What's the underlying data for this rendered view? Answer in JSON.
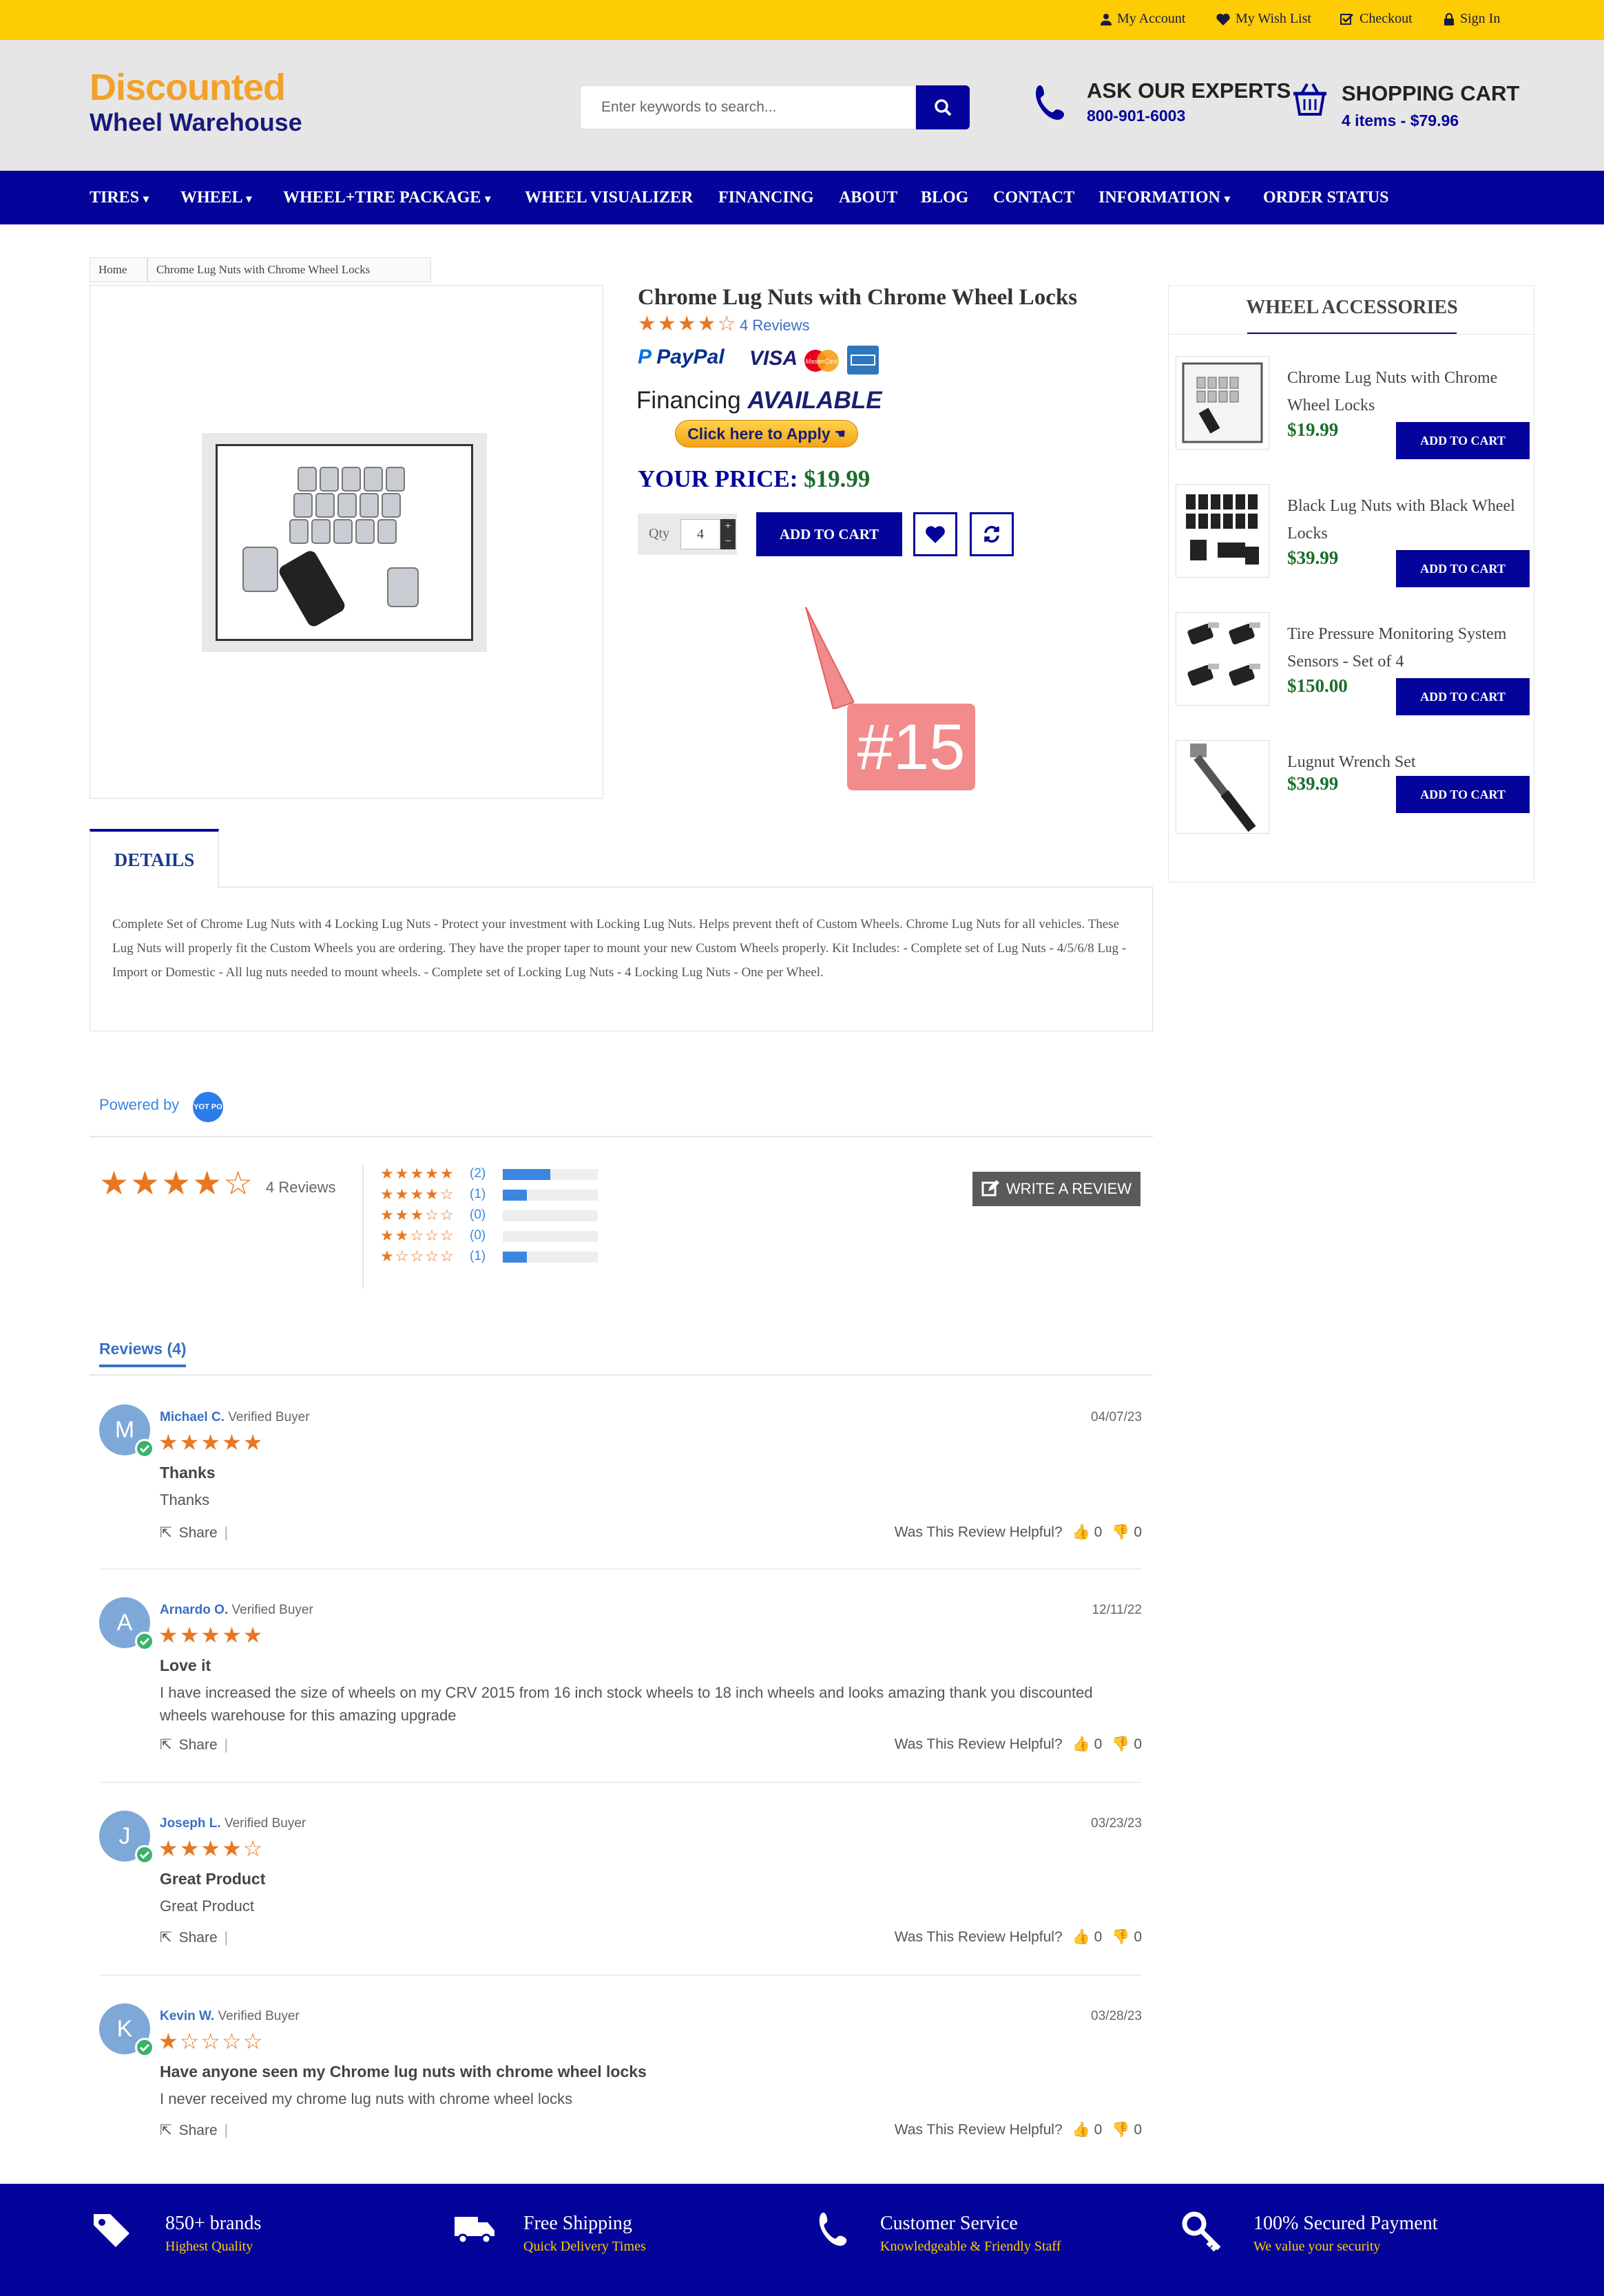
{
  "topbar": {
    "my_account": "My Account",
    "wish_list": "My Wish List",
    "checkout": "Checkout",
    "sign_in": "Sign In"
  },
  "header": {
    "logo_line1": "Discounted",
    "logo_line2": "Wheel Warehouse",
    "search_placeholder": "Enter keywords to search...",
    "experts_label": "ASK OUR EXPERTS",
    "experts_phone": "800-901-6003",
    "cart_label": "SHOPPING CART",
    "cart_summary": "4 items - $79.96"
  },
  "nav": [
    {
      "label": "TIRES",
      "dropdown": true
    },
    {
      "label": "WHEEL",
      "dropdown": true
    },
    {
      "label": "WHEEL+TIRE PACKAGE",
      "dropdown": true
    },
    {
      "label": "WHEEL VISUALIZER",
      "dropdown": false
    },
    {
      "label": "FINANCING",
      "dropdown": false
    },
    {
      "label": "ABOUT",
      "dropdown": false
    },
    {
      "label": "BLOG",
      "dropdown": false
    },
    {
      "label": "CONTACT",
      "dropdown": false
    },
    {
      "label": "INFORMATION",
      "dropdown": true
    },
    {
      "label": "ORDER STATUS",
      "dropdown": false
    }
  ],
  "breadcrumb": {
    "home": "Home",
    "current": "Chrome Lug Nuts with Chrome Wheel Locks"
  },
  "product": {
    "title": "Chrome Lug Nuts with Chrome Wheel Locks",
    "rating": 4,
    "reviews_link": "4 Reviews",
    "payments": {
      "paypal": "PayPal",
      "visa": "VISA",
      "mastercard": "MasterCard"
    },
    "financing_label": "Financing",
    "financing_available": "AVAILABLE",
    "financing_apply": "Click here to Apply",
    "price_label": "YOUR PRICE:",
    "price": "$19.99",
    "qty_label": "Qty",
    "qty_value": "4",
    "add_to_cart": "ADD TO CART"
  },
  "annotation": {
    "label": "#15",
    "color": "#f28b8b"
  },
  "sidebar": {
    "title": "WHEEL ACCESSORIES",
    "items": [
      {
        "name": "Chrome Lug Nuts with Chrome Wheel Locks",
        "price": "$19.99",
        "button": "ADD TO CART"
      },
      {
        "name": "Black Lug Nuts with Black Wheel Locks",
        "price": "$39.99",
        "button": "ADD TO CART"
      },
      {
        "name": "Tire Pressure Monitoring System Sensors - Set of 4",
        "price": "$150.00",
        "button": "ADD TO CART"
      },
      {
        "name": "Lugnut Wrench Set",
        "price": "$39.99",
        "button": "ADD TO CART"
      }
    ]
  },
  "details": {
    "tab": "DETAILS",
    "text": "Complete Set of Chrome Lug Nuts with 4 Locking Lug Nuts - Protect your investment with Locking Lug Nuts. Helps prevent theft of Custom Wheels. Chrome Lug Nuts for all vehicles. These Lug Nuts will properly fit the Custom Wheels you are ordering. They have the proper taper to mount your new Custom Wheels properly. Kit Includes: - Complete set of Lug Nuts - 4/5/6/8 Lug - Import or Domestic - All lug nuts needed to mount wheels. - Complete set of Locking Lug Nuts - 4 Locking Lug Nuts - One per Wheel."
  },
  "reviews": {
    "powered_by": "Powered by",
    "powered_logo": "YOT PO",
    "summary_count": "4 Reviews",
    "write_review": "WRITE A REVIEW",
    "distribution": [
      {
        "stars": 5,
        "count": "(2)",
        "fraction": 0.5
      },
      {
        "stars": 4,
        "count": "(1)",
        "fraction": 0.25
      },
      {
        "stars": 3,
        "count": "(0)",
        "fraction": 0
      },
      {
        "stars": 2,
        "count": "(0)",
        "fraction": 0
      },
      {
        "stars": 1,
        "count": "(1)",
        "fraction": 0.25
      }
    ],
    "tab_label": "Reviews (4)",
    "helpful_label": "Was This Review Helpful?",
    "share_label": "Share",
    "items": [
      {
        "initial": "M",
        "name": "Michael C.",
        "badge": "Verified Buyer",
        "date": "04/07/23",
        "rating": 5,
        "title": "Thanks",
        "body": "Thanks",
        "up": "0",
        "down": "0"
      },
      {
        "initial": "A",
        "name": "Arnardo O.",
        "badge": "Verified Buyer",
        "date": "12/11/22",
        "rating": 5,
        "title": "Love it",
        "body": "I have increased the size of wheels on my CRV 2015 from 16 inch stock wheels to 18 inch wheels and looks amazing thank you discounted wheels warehouse for this amazing upgrade",
        "up": "0",
        "down": "0"
      },
      {
        "initial": "J",
        "name": "Joseph L.",
        "badge": "Verified Buyer",
        "date": "03/23/23",
        "rating": 4,
        "title": "Great Product",
        "body": "Great Product",
        "up": "0",
        "down": "0"
      },
      {
        "initial": "K",
        "name": "Kevin W.",
        "badge": "Verified Buyer",
        "date": "03/28/23",
        "rating": 1,
        "title": "Have anyone seen my Chrome lug nuts with chrome wheel locks",
        "body": "I never received my chrome lug nuts with chrome wheel locks",
        "up": "0",
        "down": "0"
      }
    ]
  },
  "footer": [
    {
      "icon": "tags-icon",
      "title": "850+ brands",
      "sub": "Highest Quality"
    },
    {
      "icon": "truck-icon",
      "title": "Free Shipping",
      "sub": "Quick Delivery Times"
    },
    {
      "icon": "phone-icon",
      "title": "Customer Service",
      "sub": "Knowledgeable & Friendly Staff"
    },
    {
      "icon": "key-icon",
      "title": "100% Secured Payment",
      "sub": "We value your security"
    }
  ]
}
